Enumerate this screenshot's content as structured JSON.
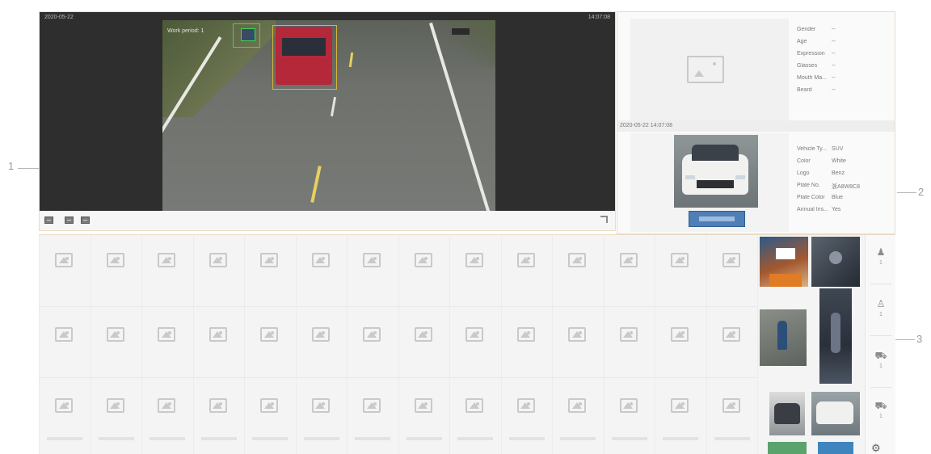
{
  "callouts": {
    "c1": "1",
    "c2": "2",
    "c3": "3"
  },
  "video": {
    "timestamp_left": "2020-05-22",
    "timestamp_right": "14:07:08",
    "overlay_text": "Work period: 1",
    "controls": [
      "layout-1-icon",
      "layout-4-icon",
      "layout-9-icon"
    ],
    "fullscreen_icon": "fullscreen-icon"
  },
  "face_attributes": {
    "placeholder_icon": "image-placeholder-icon",
    "items": [
      {
        "label": "Gender",
        "value": "--"
      },
      {
        "label": "Age",
        "value": "--"
      },
      {
        "label": "Expression",
        "value": "--"
      },
      {
        "label": "Glasses",
        "value": "--"
      },
      {
        "label": "Mouth Ma...",
        "value": "--"
      },
      {
        "label": "Beard",
        "value": "--"
      }
    ]
  },
  "capture_time": "2020-05-22 14:07:08",
  "vehicle_attributes": {
    "items": [
      {
        "label": "Vehicle Ty...",
        "value": "SUV"
      },
      {
        "label": "Color",
        "value": "White"
      },
      {
        "label": "Logo",
        "value": "Benz"
      },
      {
        "label": "Plate No.",
        "value": "浙A8W8C8"
      },
      {
        "label": "Plate Color",
        "value": "Blue"
      },
      {
        "label": "Annual Ins...",
        "value": "Yes"
      }
    ]
  },
  "sidebar": {
    "items": [
      {
        "name": "face",
        "icon": "person-icon",
        "count": "1"
      },
      {
        "name": "body",
        "icon": "body-icon",
        "count": "1"
      },
      {
        "name": "vehicle",
        "icon": "car-icon",
        "count": "1"
      },
      {
        "name": "non-motor",
        "icon": "bike-icon",
        "count": "1"
      }
    ],
    "settings_icon": "gear-icon"
  }
}
